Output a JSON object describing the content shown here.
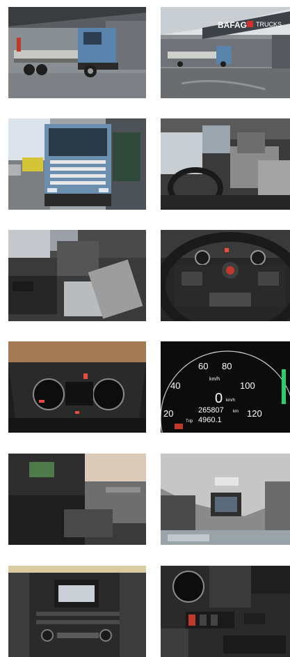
{
  "gallery": {
    "photos": [
      {
        "alt": "Truck side view",
        "icon": "truck-side-photo"
      },
      {
        "alt": "Truck at dealership",
        "icon": "truck-dealership-photo"
      },
      {
        "alt": "Truck front view",
        "icon": "truck-front-photo"
      },
      {
        "alt": "Cab interior driver seat",
        "icon": "cab-interior-photo"
      },
      {
        "alt": "Cab interior passenger area",
        "icon": "cab-passenger-photo"
      },
      {
        "alt": "Steering wheel",
        "icon": "steering-wheel-photo"
      },
      {
        "alt": "Instrument cluster",
        "icon": "instrument-cluster-photo"
      },
      {
        "alt": "Speedometer close-up",
        "icon": "speedometer-photo"
      },
      {
        "alt": "Dashboard center console",
        "icon": "center-console-photo"
      },
      {
        "alt": "Cab roof hatch",
        "icon": "roof-hatch-photo"
      },
      {
        "alt": "Radio and climate panel",
        "icon": "radio-panel-photo"
      },
      {
        "alt": "Switch panel",
        "icon": "switch-panel-photo"
      }
    ],
    "sign_text": "BAFAG",
    "sign_text2": "TRUCKS",
    "odometer_total": "265807",
    "odometer_trip": "4960.1",
    "odometer_unit": "km",
    "trip_label": "Trip",
    "speed_unit": "km/h",
    "speed_zero": "0",
    "speed_ticks": [
      "20",
      "40",
      "60",
      "80",
      "100",
      "120"
    ]
  }
}
